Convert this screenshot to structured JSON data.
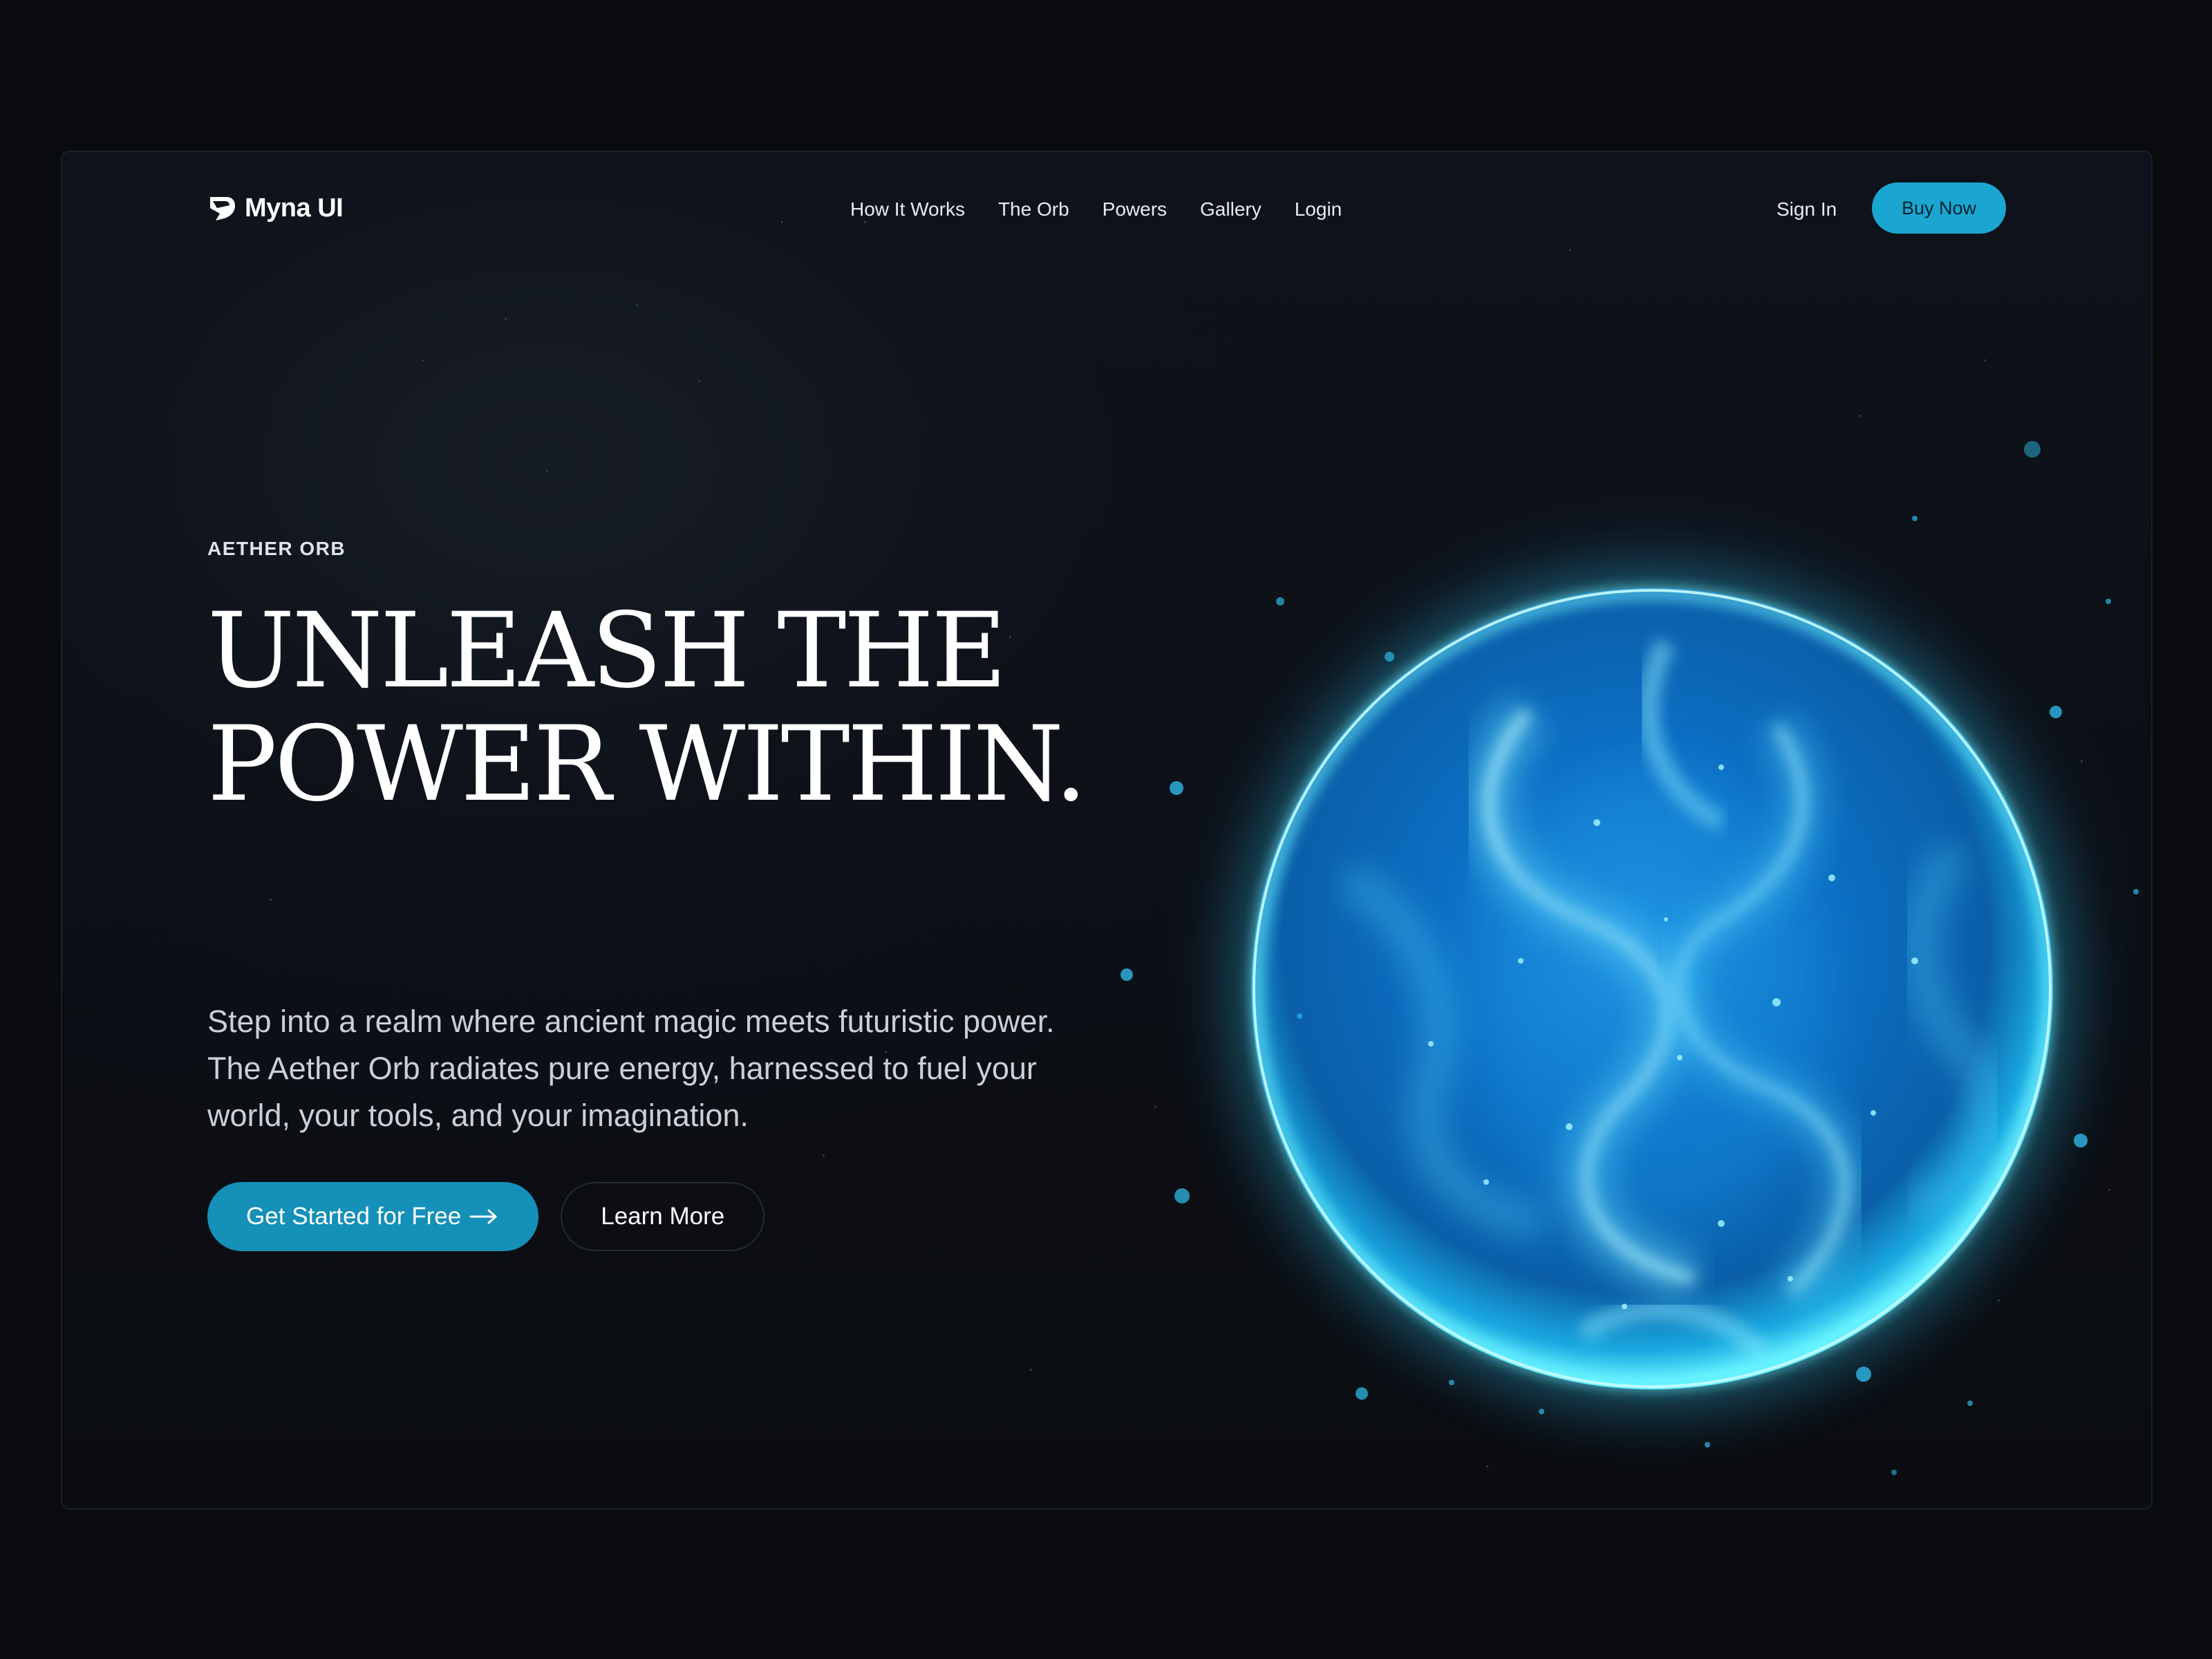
{
  "brand": {
    "name": "Myna UI",
    "logo_icon": "myna-logo-icon"
  },
  "nav": {
    "links": [
      "How It Works",
      "The Orb",
      "Powers",
      "Gallery",
      "Login"
    ],
    "sign_in": "Sign In",
    "buy_now": "Buy Now"
  },
  "hero": {
    "eyebrow": "AETHER ORB",
    "headline_line1": "UNLEASH THE",
    "headline_line2": "POWER WITHIN.",
    "description": "Step into a realm where ancient magic meets futuristic power. The Aether Orb radiates pure energy, harnessed to fuel your world, your tools, and your imagination.",
    "primary_cta": "Get Started for Free",
    "primary_cta_icon": "arrow-right-icon",
    "secondary_cta": "Learn More"
  },
  "colors": {
    "background": "#0a0b0e",
    "accent": "#1aa6d0",
    "accent_dark": "#1590b8",
    "orb_core": "#0a5fa8",
    "orb_rim": "#5ff0ff"
  }
}
